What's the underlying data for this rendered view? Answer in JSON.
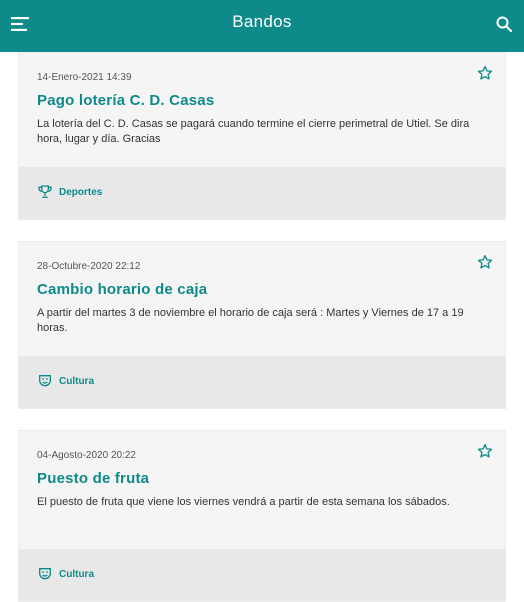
{
  "header": {
    "title": "Bandos",
    "menu_icon": "menu-icon",
    "search_icon": "search-icon"
  },
  "colors": {
    "accent": "#0f8a8a",
    "card_bg": "#f5f5f5",
    "footer_bg": "#e8e8e8"
  },
  "cards": [
    {
      "date": "14-Enero-2021 14:39",
      "title": "Pago lotería C. D. Casas",
      "body": "La lotería del C. D. Casas se pagará cuando termine el cierre perimetral de Utiel. Se dira hora, lugar y día. Gracias",
      "category": "Deportes",
      "category_icon": "trophy-icon"
    },
    {
      "date": "28-Octubre-2020 22:12",
      "title": "Cambio horario de caja",
      "body": "A partir del martes 3 de noviembre el horario de caja será : Martes y Viernes de 17 a 19 horas.",
      "category": "Cultura",
      "category_icon": "theater-masks-icon"
    },
    {
      "date": "04-Agosto-2020 20:22",
      "title": "Puesto de fruta",
      "body": "El puesto de fruta que viene los viernes vendrá a partir de esta semana los sábados.",
      "category": "Cultura",
      "category_icon": "theater-masks-icon"
    }
  ]
}
